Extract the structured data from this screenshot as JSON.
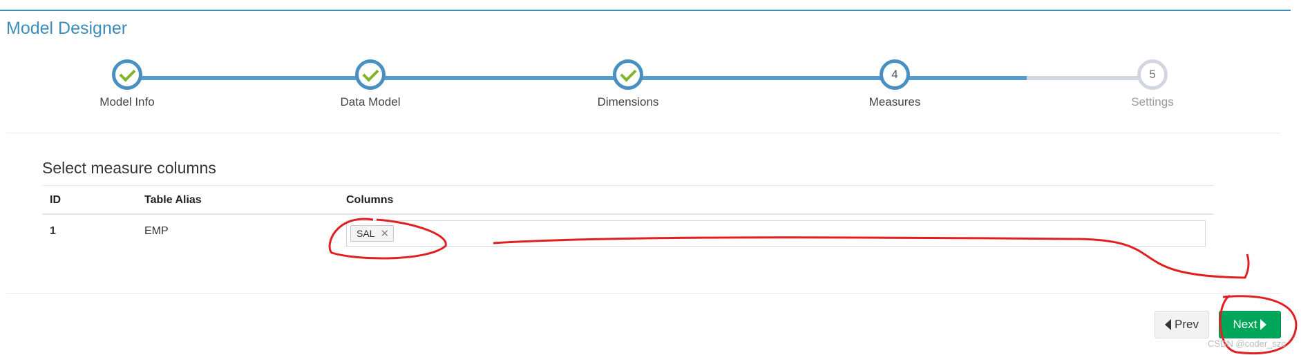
{
  "header": {
    "title": "Model Designer"
  },
  "wizard": {
    "steps": [
      {
        "number": "1",
        "label": "Model Info",
        "state": "done"
      },
      {
        "number": "2",
        "label": "Data Model",
        "state": "done"
      },
      {
        "number": "3",
        "label": "Dimensions",
        "state": "done"
      },
      {
        "number": "4",
        "label": "Measures",
        "state": "active"
      },
      {
        "number": "5",
        "label": "Settings",
        "state": "pending"
      }
    ]
  },
  "section": {
    "title": "Select measure columns"
  },
  "table": {
    "headers": [
      "ID",
      "Table Alias",
      "Columns"
    ],
    "rows": [
      {
        "id": "1",
        "alias": "EMP",
        "columns": [
          "SAL"
        ]
      }
    ]
  },
  "buttons": {
    "prev_label": "Prev",
    "next_label": "Next"
  },
  "watermark": "CSDN @coder_szc",
  "colors": {
    "accent": "#3c8dbc",
    "step_done_check": "#7fb528",
    "next_button": "#00a65a",
    "annotation_stroke": "#e02020"
  }
}
